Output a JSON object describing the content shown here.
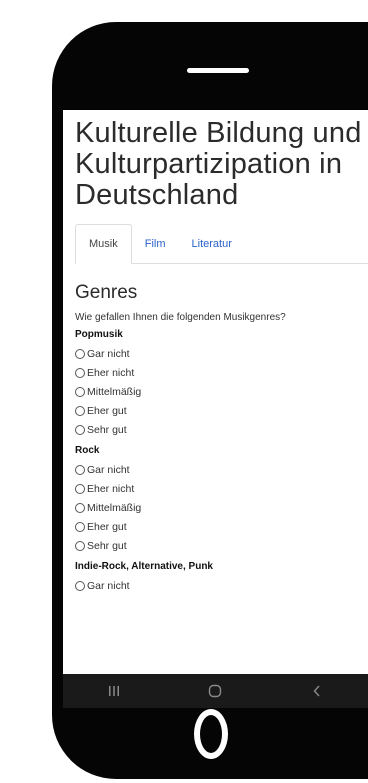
{
  "page": {
    "title": "Kulturelle Bildung und Kulturpartizipation in Deutschland"
  },
  "tabs": [
    {
      "label": "Musik",
      "active": true
    },
    {
      "label": "Film",
      "active": false
    },
    {
      "label": "Literatur",
      "active": false
    }
  ],
  "section": {
    "title": "Genres",
    "question": "Wie gefallen Ihnen die folgenden Musikgenres?"
  },
  "groups": [
    {
      "label": "Popmusik",
      "options": [
        "Gar nicht",
        "Eher nicht",
        "Mittelmäßig",
        "Eher gut",
        "Sehr gut"
      ]
    },
    {
      "label": "Rock",
      "options": [
        "Gar nicht",
        "Eher nicht",
        "Mittelmäßig",
        "Eher gut",
        "Sehr gut"
      ]
    },
    {
      "label": "Indie-Rock, Alternative, Punk",
      "options": [
        "Gar nicht"
      ]
    }
  ],
  "navbar": {
    "icons": [
      "recent-apps-icon",
      "home-icon",
      "back-icon"
    ],
    "color": "#1a1a1a"
  }
}
